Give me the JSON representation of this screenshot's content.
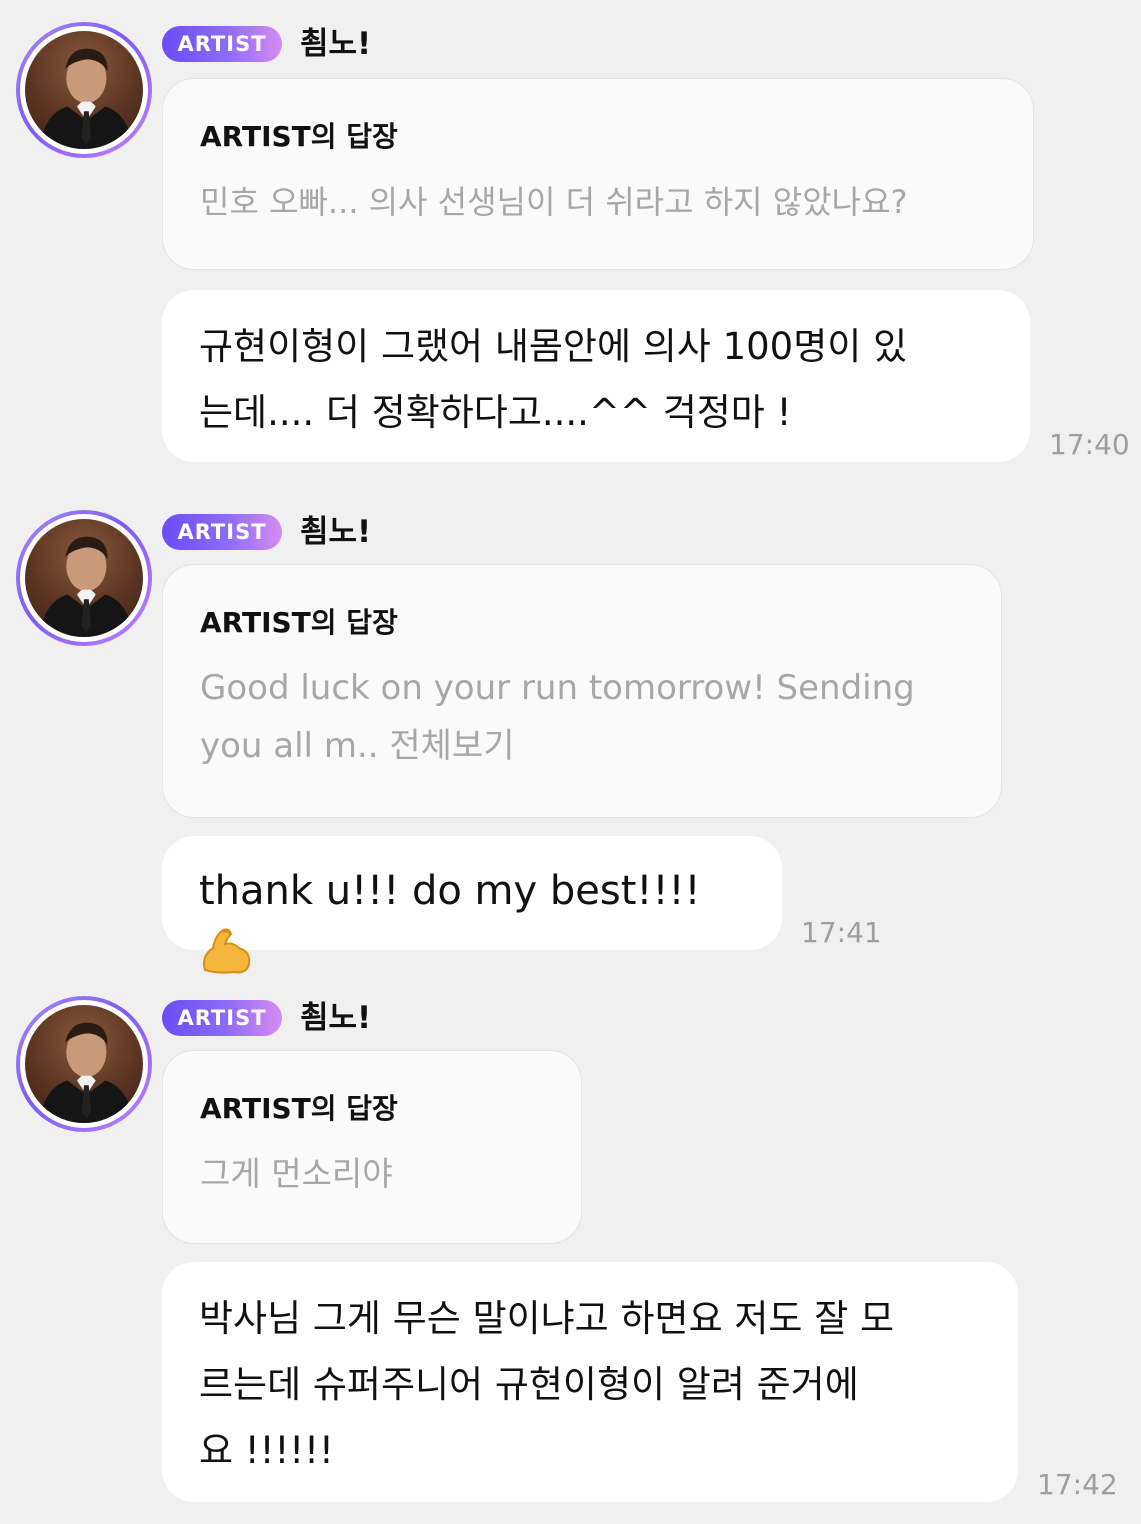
{
  "groups": [
    {
      "sender": {
        "badge": "ARTIST",
        "name": "쵬노!"
      },
      "reply": {
        "title": "ARTIST의 답장",
        "text": "민호 오빠... 의사 선생님이 더 쉬라고 하지 않았나요?"
      },
      "message": {
        "lines": [
          "규현이형이 그랬어 내몸안에 의사 100명이 있",
          "는데.... 더 정확하다고....^^  걱정마 !"
        ]
      },
      "time": "17:40"
    },
    {
      "sender": {
        "badge": "ARTIST",
        "name": "쵬노!"
      },
      "reply": {
        "title": "ARTIST의 답장",
        "lines": [
          "Good luck on your run tomorrow! Sending",
          "you all m.. 전체보기"
        ]
      },
      "message": {
        "text": "thank u!!! do my best!!!!",
        "emoji": "flexed-biceps-icon"
      },
      "time": "17:41"
    },
    {
      "sender": {
        "badge": "ARTIST",
        "name": "쵬노!"
      },
      "reply": {
        "title": "ARTIST의 답장",
        "text": "그게 먼소리야"
      },
      "message": {
        "lines": [
          "박사님 그게 무슨 말이냐고 하면요 저도 잘 모",
          "르는데 슈퍼주니어 규현이형이 알려 준거에",
          "요 !!!!!!"
        ]
      },
      "time": "17:42"
    }
  ],
  "colors": {
    "background": "#f0f0f0",
    "badge_start": "#6a4cf5",
    "badge_end": "#d68cf0",
    "reply_text": "#a7a7a7",
    "time": "#9e9e9e"
  }
}
